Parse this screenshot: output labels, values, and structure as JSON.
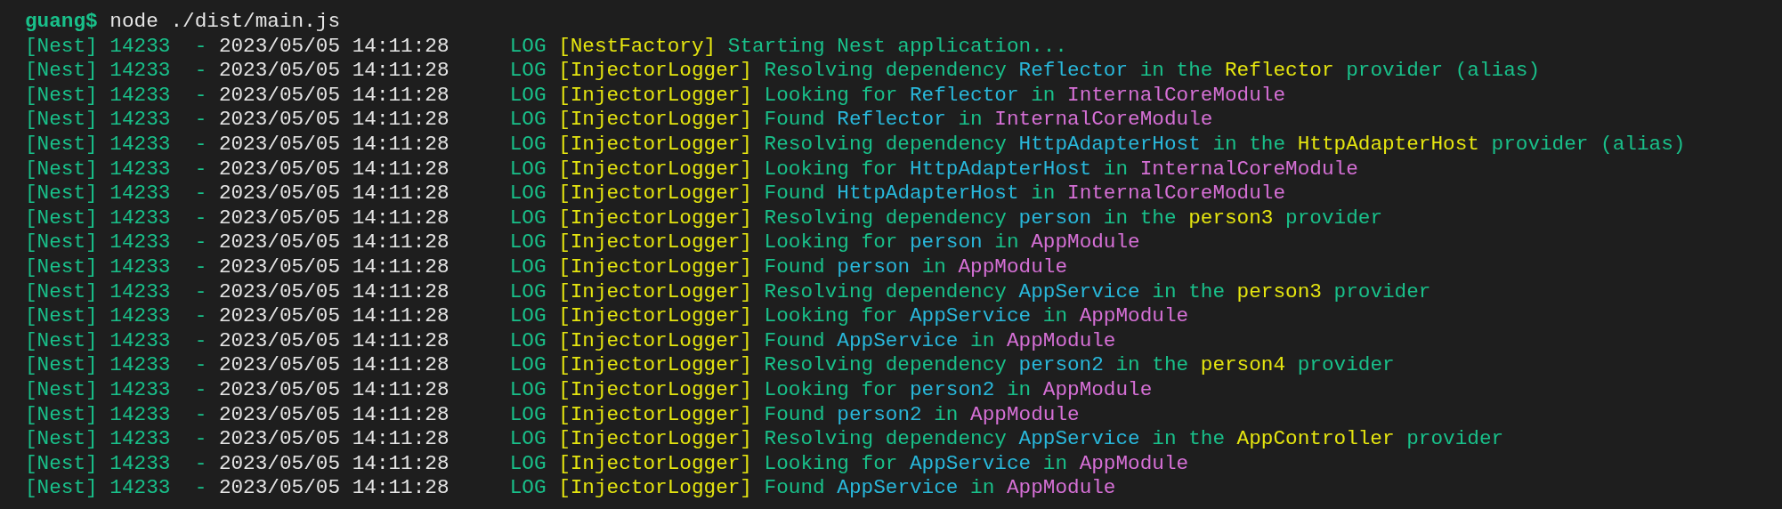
{
  "prompt": {
    "user": "guang$",
    "command": "node ./dist/main.js"
  },
  "lines": [
    {
      "app": "[Nest]",
      "pid": "14233",
      "dash": "-",
      "timestamp": "2023/05/05 14:11:28",
      "level": "LOG",
      "context": "[NestFactory]",
      "message": [
        {
          "kind": "text",
          "text": "Starting Nest application..."
        }
      ]
    },
    {
      "app": "[Nest]",
      "pid": "14233",
      "dash": "-",
      "timestamp": "2023/05/05 14:11:28",
      "level": "LOG",
      "context": "[InjectorLogger]",
      "message": [
        {
          "kind": "text",
          "text": "Resolving dependency "
        },
        {
          "kind": "token",
          "text": "Reflector"
        },
        {
          "kind": "text",
          "text": " in the "
        },
        {
          "kind": "provider",
          "text": "Reflector"
        },
        {
          "kind": "text",
          "text": " provider (alias)"
        }
      ]
    },
    {
      "app": "[Nest]",
      "pid": "14233",
      "dash": "-",
      "timestamp": "2023/05/05 14:11:28",
      "level": "LOG",
      "context": "[InjectorLogger]",
      "message": [
        {
          "kind": "text",
          "text": "Looking for "
        },
        {
          "kind": "token",
          "text": "Reflector"
        },
        {
          "kind": "text",
          "text": " in "
        },
        {
          "kind": "module",
          "text": "InternalCoreModule"
        }
      ]
    },
    {
      "app": "[Nest]",
      "pid": "14233",
      "dash": "-",
      "timestamp": "2023/05/05 14:11:28",
      "level": "LOG",
      "context": "[InjectorLogger]",
      "message": [
        {
          "kind": "text",
          "text": "Found "
        },
        {
          "kind": "token",
          "text": "Reflector"
        },
        {
          "kind": "text",
          "text": " in "
        },
        {
          "kind": "module",
          "text": "InternalCoreModule"
        }
      ]
    },
    {
      "app": "[Nest]",
      "pid": "14233",
      "dash": "-",
      "timestamp": "2023/05/05 14:11:28",
      "level": "LOG",
      "context": "[InjectorLogger]",
      "message": [
        {
          "kind": "text",
          "text": "Resolving dependency "
        },
        {
          "kind": "token",
          "text": "HttpAdapterHost"
        },
        {
          "kind": "text",
          "text": " in the "
        },
        {
          "kind": "provider",
          "text": "HttpAdapterHost"
        },
        {
          "kind": "text",
          "text": " provider (alias)"
        }
      ]
    },
    {
      "app": "[Nest]",
      "pid": "14233",
      "dash": "-",
      "timestamp": "2023/05/05 14:11:28",
      "level": "LOG",
      "context": "[InjectorLogger]",
      "message": [
        {
          "kind": "text",
          "text": "Looking for "
        },
        {
          "kind": "token",
          "text": "HttpAdapterHost"
        },
        {
          "kind": "text",
          "text": " in "
        },
        {
          "kind": "module",
          "text": "InternalCoreModule"
        }
      ]
    },
    {
      "app": "[Nest]",
      "pid": "14233",
      "dash": "-",
      "timestamp": "2023/05/05 14:11:28",
      "level": "LOG",
      "context": "[InjectorLogger]",
      "message": [
        {
          "kind": "text",
          "text": "Found "
        },
        {
          "kind": "token",
          "text": "HttpAdapterHost"
        },
        {
          "kind": "text",
          "text": " in "
        },
        {
          "kind": "module",
          "text": "InternalCoreModule"
        }
      ]
    },
    {
      "app": "[Nest]",
      "pid": "14233",
      "dash": "-",
      "timestamp": "2023/05/05 14:11:28",
      "level": "LOG",
      "context": "[InjectorLogger]",
      "message": [
        {
          "kind": "text",
          "text": "Resolving dependency "
        },
        {
          "kind": "token",
          "text": "person"
        },
        {
          "kind": "text",
          "text": " in the "
        },
        {
          "kind": "provider",
          "text": "person3"
        },
        {
          "kind": "text",
          "text": " provider"
        }
      ]
    },
    {
      "app": "[Nest]",
      "pid": "14233",
      "dash": "-",
      "timestamp": "2023/05/05 14:11:28",
      "level": "LOG",
      "context": "[InjectorLogger]",
      "message": [
        {
          "kind": "text",
          "text": "Looking for "
        },
        {
          "kind": "token",
          "text": "person"
        },
        {
          "kind": "text",
          "text": " in "
        },
        {
          "kind": "module",
          "text": "AppModule"
        }
      ]
    },
    {
      "app": "[Nest]",
      "pid": "14233",
      "dash": "-",
      "timestamp": "2023/05/05 14:11:28",
      "level": "LOG",
      "context": "[InjectorLogger]",
      "message": [
        {
          "kind": "text",
          "text": "Found "
        },
        {
          "kind": "token",
          "text": "person"
        },
        {
          "kind": "text",
          "text": " in "
        },
        {
          "kind": "module",
          "text": "AppModule"
        }
      ]
    },
    {
      "app": "[Nest]",
      "pid": "14233",
      "dash": "-",
      "timestamp": "2023/05/05 14:11:28",
      "level": "LOG",
      "context": "[InjectorLogger]",
      "message": [
        {
          "kind": "text",
          "text": "Resolving dependency "
        },
        {
          "kind": "token",
          "text": "AppService"
        },
        {
          "kind": "text",
          "text": " in the "
        },
        {
          "kind": "provider",
          "text": "person3"
        },
        {
          "kind": "text",
          "text": " provider"
        }
      ]
    },
    {
      "app": "[Nest]",
      "pid": "14233",
      "dash": "-",
      "timestamp": "2023/05/05 14:11:28",
      "level": "LOG",
      "context": "[InjectorLogger]",
      "message": [
        {
          "kind": "text",
          "text": "Looking for "
        },
        {
          "kind": "token",
          "text": "AppService"
        },
        {
          "kind": "text",
          "text": " in "
        },
        {
          "kind": "module",
          "text": "AppModule"
        }
      ]
    },
    {
      "app": "[Nest]",
      "pid": "14233",
      "dash": "-",
      "timestamp": "2023/05/05 14:11:28",
      "level": "LOG",
      "context": "[InjectorLogger]",
      "message": [
        {
          "kind": "text",
          "text": "Found "
        },
        {
          "kind": "token",
          "text": "AppService"
        },
        {
          "kind": "text",
          "text": " in "
        },
        {
          "kind": "module",
          "text": "AppModule"
        }
      ]
    },
    {
      "app": "[Nest]",
      "pid": "14233",
      "dash": "-",
      "timestamp": "2023/05/05 14:11:28",
      "level": "LOG",
      "context": "[InjectorLogger]",
      "message": [
        {
          "kind": "text",
          "text": "Resolving dependency "
        },
        {
          "kind": "token",
          "text": "person2"
        },
        {
          "kind": "text",
          "text": " in the "
        },
        {
          "kind": "provider",
          "text": "person4"
        },
        {
          "kind": "text",
          "text": " provider"
        }
      ]
    },
    {
      "app": "[Nest]",
      "pid": "14233",
      "dash": "-",
      "timestamp": "2023/05/05 14:11:28",
      "level": "LOG",
      "context": "[InjectorLogger]",
      "message": [
        {
          "kind": "text",
          "text": "Looking for "
        },
        {
          "kind": "token",
          "text": "person2"
        },
        {
          "kind": "text",
          "text": " in "
        },
        {
          "kind": "module",
          "text": "AppModule"
        }
      ]
    },
    {
      "app": "[Nest]",
      "pid": "14233",
      "dash": "-",
      "timestamp": "2023/05/05 14:11:28",
      "level": "LOG",
      "context": "[InjectorLogger]",
      "message": [
        {
          "kind": "text",
          "text": "Found "
        },
        {
          "kind": "token",
          "text": "person2"
        },
        {
          "kind": "text",
          "text": " in "
        },
        {
          "kind": "module",
          "text": "AppModule"
        }
      ]
    },
    {
      "app": "[Nest]",
      "pid": "14233",
      "dash": "-",
      "timestamp": "2023/05/05 14:11:28",
      "level": "LOG",
      "context": "[InjectorLogger]",
      "message": [
        {
          "kind": "text",
          "text": "Resolving dependency "
        },
        {
          "kind": "token",
          "text": "AppService"
        },
        {
          "kind": "text",
          "text": " in the "
        },
        {
          "kind": "provider",
          "text": "AppController"
        },
        {
          "kind": "text",
          "text": " provider"
        }
      ]
    },
    {
      "app": "[Nest]",
      "pid": "14233",
      "dash": "-",
      "timestamp": "2023/05/05 14:11:28",
      "level": "LOG",
      "context": "[InjectorLogger]",
      "message": [
        {
          "kind": "text",
          "text": "Looking for "
        },
        {
          "kind": "token",
          "text": "AppService"
        },
        {
          "kind": "text",
          "text": " in "
        },
        {
          "kind": "module",
          "text": "AppModule"
        }
      ]
    },
    {
      "app": "[Nest]",
      "pid": "14233",
      "dash": "-",
      "timestamp": "2023/05/05 14:11:28",
      "level": "LOG",
      "context": "[InjectorLogger]",
      "message": [
        {
          "kind": "text",
          "text": "Found "
        },
        {
          "kind": "token",
          "text": "AppService"
        },
        {
          "kind": "text",
          "text": " in "
        },
        {
          "kind": "module",
          "text": "AppModule"
        }
      ]
    }
  ]
}
